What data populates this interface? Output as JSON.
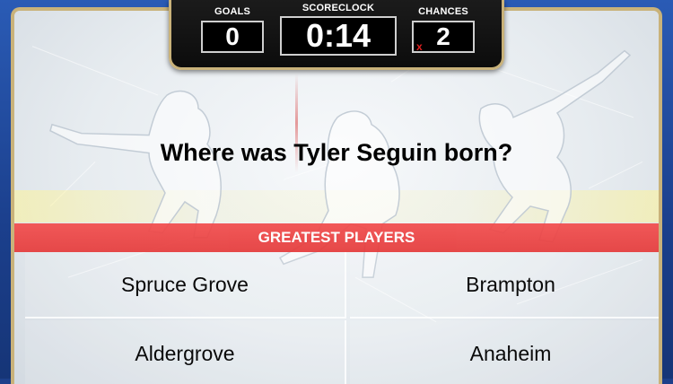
{
  "scoreboard": {
    "goals_label": "GOALS",
    "goals_value": "0",
    "clock_label": "SCORECLOCK",
    "clock_value": "0:14",
    "chances_label": "CHANCES",
    "chances_value": "2",
    "strike_mark": "x"
  },
  "question": "Where was Tyler Seguin born?",
  "category": "GREATEST PLAYERS",
  "answers": [
    {
      "label": "Spruce Grove"
    },
    {
      "label": "Brampton"
    },
    {
      "label": "Aldergrove"
    },
    {
      "label": "Anaheim"
    }
  ],
  "colors": {
    "frame_blue": "#1d3f8a",
    "gold_trim": "#c9b27a",
    "category_red": "#e53a3a",
    "strike_red": "#e02020"
  }
}
